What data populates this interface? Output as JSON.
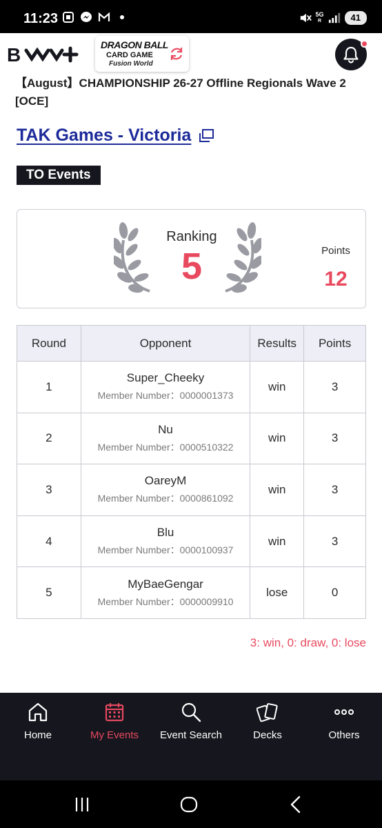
{
  "status_bar": {
    "time": "11:23",
    "network_top": "5G",
    "network_bottom": "R",
    "battery": "41"
  },
  "header": {
    "app_logo_text": "BCG+",
    "game_logo": {
      "line1": "DRAGON BALL",
      "line2": "CARD GAME",
      "line3": "Fusion World"
    }
  },
  "event": {
    "title": "【August】CHAMPIONSHIP 26-27 Offline Regionals Wave 2 [OCE]",
    "shop_name": "TAK Games - Victoria",
    "tag": "TO Events"
  },
  "summary": {
    "ranking_label": "Ranking",
    "ranking_value": "5",
    "points_label": "Points",
    "points_value": "12"
  },
  "table": {
    "headers": [
      "Round",
      "Opponent",
      "Results",
      "Points"
    ],
    "rows": [
      {
        "round": "1",
        "opponent": "Super_Cheeky",
        "member": "Member Number：0000001373",
        "result": "win",
        "points": "3"
      },
      {
        "round": "2",
        "opponent": "Nu",
        "member": "Member Number：0000510322",
        "result": "win",
        "points": "3"
      },
      {
        "round": "3",
        "opponent": "OareyM",
        "member": "Member Number：0000861092",
        "result": "win",
        "points": "3"
      },
      {
        "round": "4",
        "opponent": "Blu",
        "member": "Member Number：0000100937",
        "result": "win",
        "points": "3"
      },
      {
        "round": "5",
        "opponent": "MyBaeGengar",
        "member": "Member Number：0000009910",
        "result": "lose",
        "points": "0"
      }
    ]
  },
  "legend_note": "3: win, 0: draw, 0: lose",
  "bottom_nav": {
    "items": [
      {
        "label": "Home",
        "icon": "home-icon"
      },
      {
        "label": "My Events",
        "icon": "calendar-icon"
      },
      {
        "label": "Event Search",
        "icon": "search-icon"
      },
      {
        "label": "Decks",
        "icon": "cards-icon"
      },
      {
        "label": "Others",
        "icon": "more-icon"
      }
    ],
    "active": "My Events"
  },
  "colors": {
    "accent": "#e8495f",
    "link": "#1d2b9a",
    "dark": "#16161e",
    "table_header_bg": "#edeef6"
  }
}
